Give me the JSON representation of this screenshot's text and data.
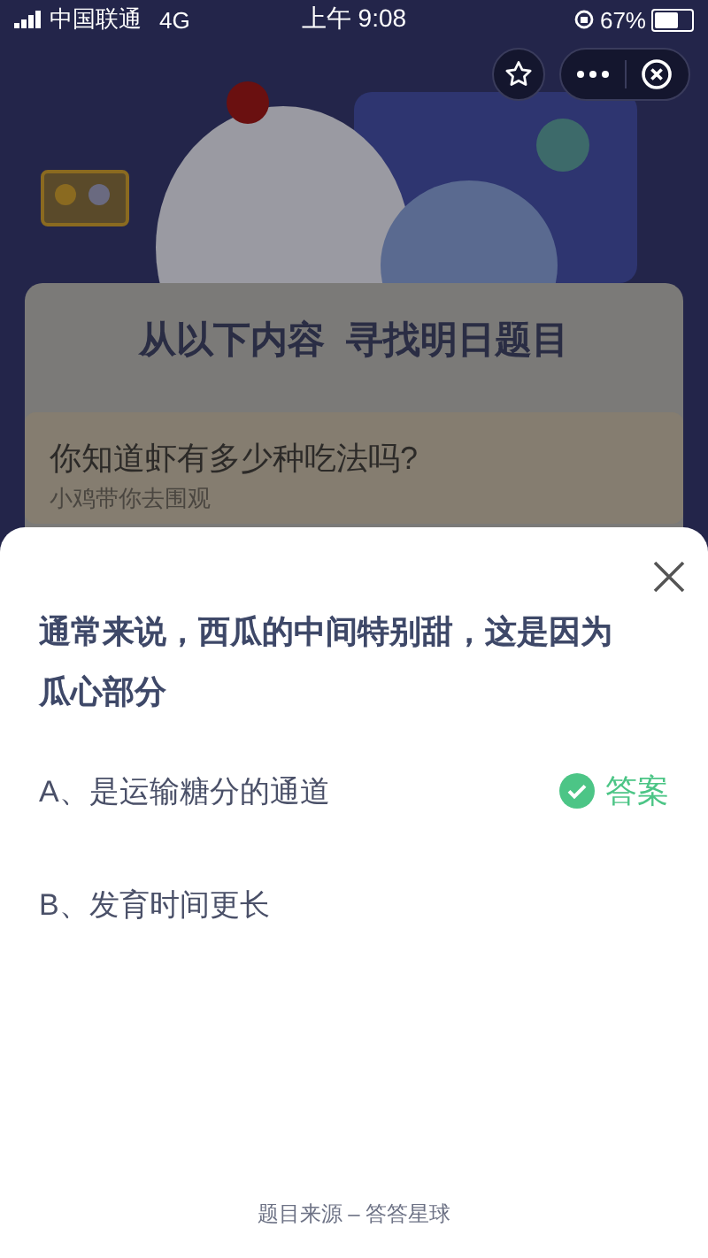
{
  "status_bar": {
    "carrier": "中国联通",
    "network": "4G",
    "time": "上午 9:08",
    "battery": "67%"
  },
  "background": {
    "banner_title": "从以下内容  寻找明日题目",
    "article_title": "你知道虾有多少种吃法吗?",
    "article_subtitle": "小鸡带你去围观"
  },
  "quiz": {
    "question": "通常来说，西瓜的中间特别甜，这是因为瓜心部分",
    "options": [
      {
        "label": "A、是运输糖分的通道",
        "correct": true,
        "badge": "答案"
      },
      {
        "label": "B、发育时间更长",
        "correct": false
      }
    ],
    "source": "题目来源 – 答答星球"
  }
}
